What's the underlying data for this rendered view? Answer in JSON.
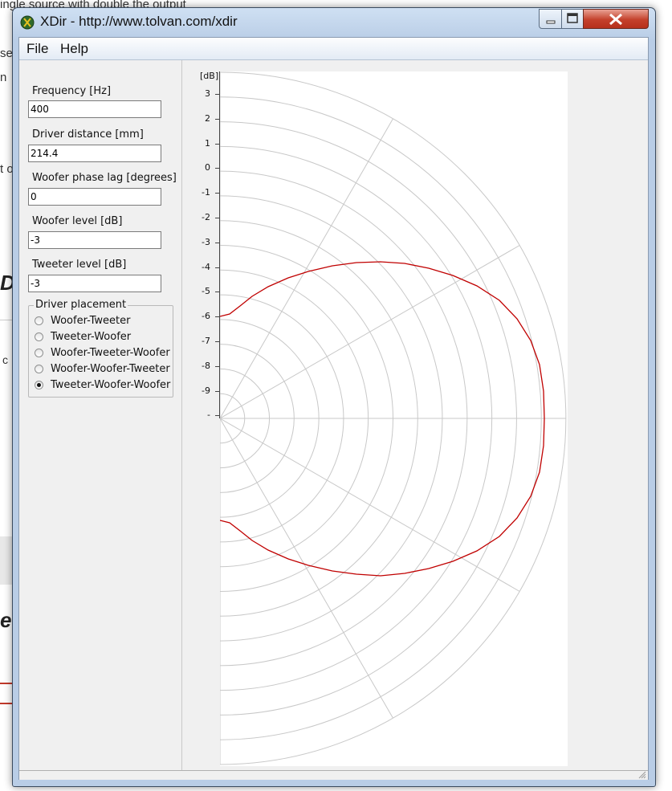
{
  "window": {
    "title": "XDir - http://www.tolvan.com/xdir",
    "icon": "xdir-app-icon"
  },
  "menu": {
    "items": [
      "File",
      "Help"
    ]
  },
  "fields": [
    {
      "label": "Frequency [Hz]",
      "value": "400"
    },
    {
      "label": "Driver distance [mm]",
      "value": "214.4"
    },
    {
      "label": "Woofer phase lag [degrees]",
      "value": "0"
    },
    {
      "label": "Woofer level [dB]",
      "value": "-3"
    },
    {
      "label": "Tweeter level [dB]",
      "value": "-3"
    }
  ],
  "placement": {
    "legend": "Driver placement",
    "options": [
      "Woofer-Tweeter",
      "Tweeter-Woofer",
      "Woofer-Tweeter-Woofer",
      "Woofer-Woofer-Tweeter",
      "Tweeter-Woofer-Woofer"
    ],
    "selected": "Tweeter-Woofer-Woofer"
  },
  "plot": {
    "unit_label": "[dB]",
    "tick_labels": [
      "3",
      "2",
      "1",
      "0",
      "-1",
      "-2",
      "-3",
      "-4",
      "-5",
      "-6",
      "-7",
      "-8",
      "-9",
      "-"
    ],
    "curve_color": "#c00000",
    "grid_color": "#c8c8c8"
  },
  "background_page": {
    "fragments": [
      "ingle source with double the output",
      "se",
      "n",
      "t o",
      "D",
      "c",
      "e"
    ]
  }
}
